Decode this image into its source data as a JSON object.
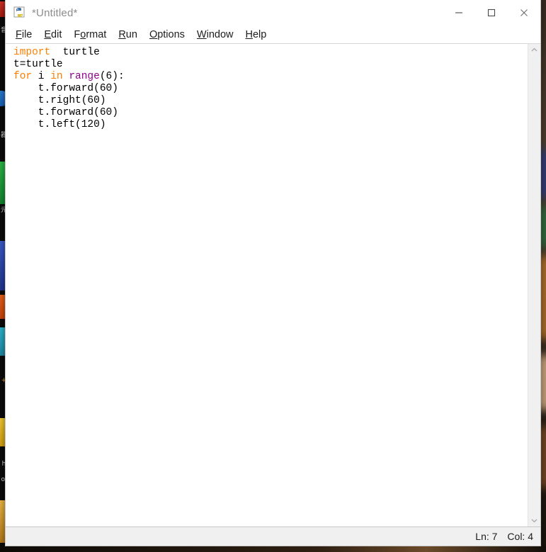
{
  "window": {
    "title": "*Untitled*",
    "app_icon": "python-idle-icon",
    "controls": {
      "minimize_label": "Minimize",
      "maximize_label": "Maximize",
      "close_label": "Close"
    }
  },
  "menubar": {
    "items": [
      {
        "label": "File",
        "pre": "",
        "accel": "F",
        "post": "ile"
      },
      {
        "label": "Edit",
        "pre": "",
        "accel": "E",
        "post": "dit"
      },
      {
        "label": "Format",
        "pre": "F",
        "accel": "o",
        "post": "rmat"
      },
      {
        "label": "Run",
        "pre": "",
        "accel": "R",
        "post": "un"
      },
      {
        "label": "Options",
        "pre": "",
        "accel": "O",
        "post": "ptions"
      },
      {
        "label": "Window",
        "pre": "",
        "accel": "W",
        "post": "indow"
      },
      {
        "label": "Help",
        "pre": "",
        "accel": "H",
        "post": "elp"
      }
    ]
  },
  "editor": {
    "language": "python",
    "code_text": "import  turtle\nt=turtle\nfor i in range(6):\n    t.forward(60)\n    t.right(60)\n    t.forward(60)\n    t.left(120)",
    "lines": [
      {
        "tokens": [
          {
            "t": "import",
            "c": "kw"
          },
          {
            "t": "  turtle",
            "c": "plain"
          }
        ]
      },
      {
        "tokens": [
          {
            "t": "t=turtle",
            "c": "plain"
          }
        ]
      },
      {
        "tokens": [
          {
            "t": "for",
            "c": "kw"
          },
          {
            "t": " i ",
            "c": "plain"
          },
          {
            "t": "in",
            "c": "kw"
          },
          {
            "t": " ",
            "c": "plain"
          },
          {
            "t": "range",
            "c": "bi"
          },
          {
            "t": "(6):",
            "c": "plain"
          }
        ]
      },
      {
        "tokens": [
          {
            "t": "    t.forward(60)",
            "c": "plain"
          }
        ]
      },
      {
        "tokens": [
          {
            "t": "    t.right(60)",
            "c": "plain"
          }
        ]
      },
      {
        "tokens": [
          {
            "t": "    t.forward(60)",
            "c": "plain"
          }
        ]
      },
      {
        "tokens": [
          {
            "t": "    t.left(120)",
            "c": "plain"
          }
        ]
      }
    ],
    "colors": {
      "keyword": "#ff8000",
      "builtin": "#900090",
      "text": "#000000",
      "background": "#ffffff"
    }
  },
  "scrollbar": {
    "up_arrow": "chevron-up-icon",
    "down_arrow": "chevron-down-icon"
  },
  "statusbar": {
    "line_label": "Ln: 7",
    "col_label": "Col: 4"
  },
  "desktop": {
    "dock_glyphs": [
      "音",
      "器",
      "元",
      "+",
      "h",
      "oi"
    ]
  }
}
